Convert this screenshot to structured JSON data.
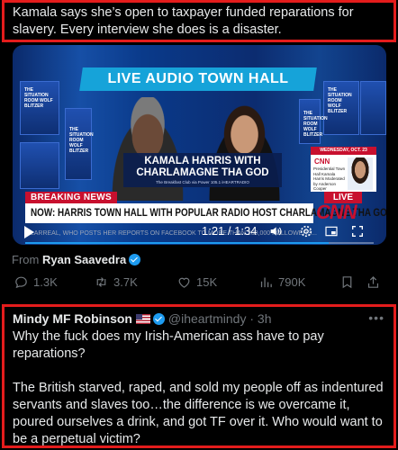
{
  "top_tweet": {
    "text": "Kamala says she’s open to taxpayer funded reparations for slavery. Every interview she does is a disaster.",
    "video": {
      "headline": "LIVE AUDIO TOWN HALL",
      "guest_card_line1": "KAMALA HARRIS WITH",
      "guest_card_line2": "CHARLAMAGNE THA GOD",
      "guest_card_sub": "The Breakfast Club via Power 105.1 iHEARTRADIO",
      "side_card_date": "WEDNESDAY, OCT. 23",
      "side_card_brand": "CNN",
      "side_card_text": "Presidential Town Hall Kamala Harris Moderated by Anderson Cooper",
      "screen_text": "THE SITUATION ROOM WOLF BLITZER",
      "breaking_label": "BREAKING NEWS",
      "live_label": "LIVE",
      "ticker": "NOW: HARRIS TOWN HALL WITH POPULAR RADIO HOST CHARLAMAGNE THA GOD",
      "network_logo": "CNN",
      "crawl": "...LARREAL, WHO POSTS HER REPORTS ON FACEBOOK TO MORE THAN 200,000 FOLLOWERS...",
      "timecode": "1:21 / 1:34",
      "progress": 0.87
    },
    "from_label": "From",
    "from_name": "Ryan Saavedra",
    "actions": {
      "replies": "1.3K",
      "retweets": "3.7K",
      "likes": "15K",
      "views": "790K"
    }
  },
  "reply": {
    "name": "Mindy MF Robinson",
    "handle": "@iheartmindy",
    "separator": "·",
    "time": "3h",
    "paragraph1": "Why the fuck does my Irish-American ass have to pay reparations?",
    "paragraph2": "The British starved, raped, and sold my people off as indentured servants and slaves too…the difference is we overcame it, poured ourselves a drink, and got TF over it. Who would want to be a perpetual victim?"
  }
}
